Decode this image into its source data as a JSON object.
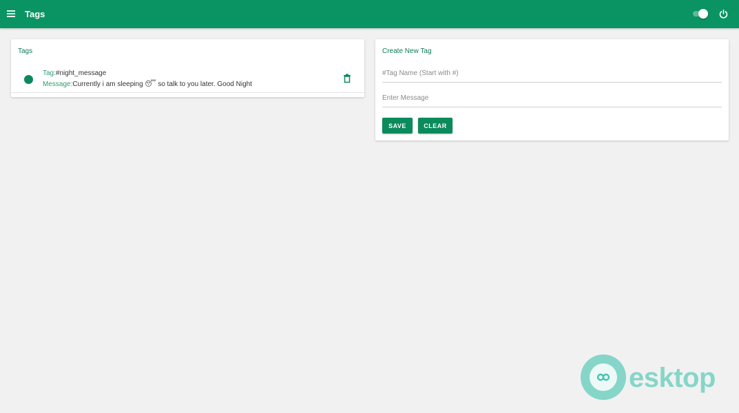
{
  "appbar": {
    "title": "Tags",
    "menu_icon": "menu-icon",
    "toggle_icon": "toggle-switch",
    "power_icon": "power-icon",
    "color": "#0b9463"
  },
  "tags_card": {
    "title": "Tags",
    "items": [
      {
        "tag_label": "Tag:",
        "tag_value": "#night_message",
        "message_label": "Message:",
        "message_value": "Currently i am sleeping 😴  so talk to you later. Good Night",
        "delete_icon": "trash-icon"
      }
    ]
  },
  "create_card": {
    "title": "Create New Tag",
    "tag_name_placeholder": "#Tag Name (Start with #)",
    "tag_name_value": "",
    "message_placeholder": "Enter Message",
    "message_value": "",
    "save_label": "SAVE",
    "clear_label": "CLEAR"
  },
  "watermark": {
    "text": "esktop",
    "icon": "desktop-logo-icon"
  }
}
